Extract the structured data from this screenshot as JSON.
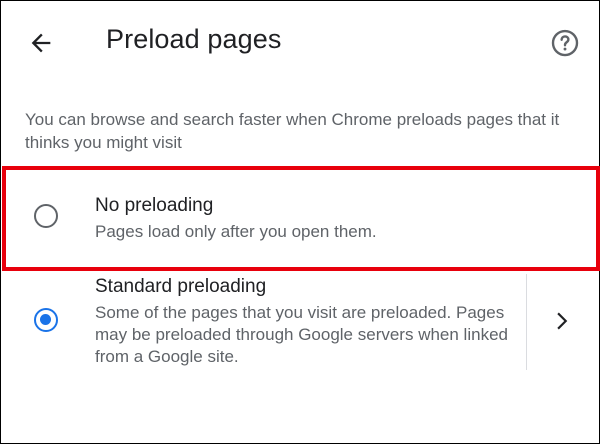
{
  "app_bar": {
    "back_icon": "arrow-back-icon",
    "title": "Preload pages",
    "help_icon": "help-circle-icon"
  },
  "description": "You can browse and search faster when Chrome preloads pages that it thinks you might visit",
  "options": [
    {
      "id": "no_preloading",
      "title": "No preloading",
      "subtitle": "Pages load only after you open them.",
      "selected": false,
      "highlighted": true
    },
    {
      "id": "standard_preloading",
      "title": "Standard preloading",
      "subtitle": "Some of the pages that you visit are preloaded. Pages may be preloaded through Google servers when linked from a Google site.",
      "selected": true,
      "details_icon": "chevron-right-icon"
    }
  ],
  "colors": {
    "accent": "#1a73e8",
    "highlight_border": "#e8000c",
    "primary_text": "#202124",
    "secondary_text": "#5f6368",
    "divider": "#dadce0"
  }
}
